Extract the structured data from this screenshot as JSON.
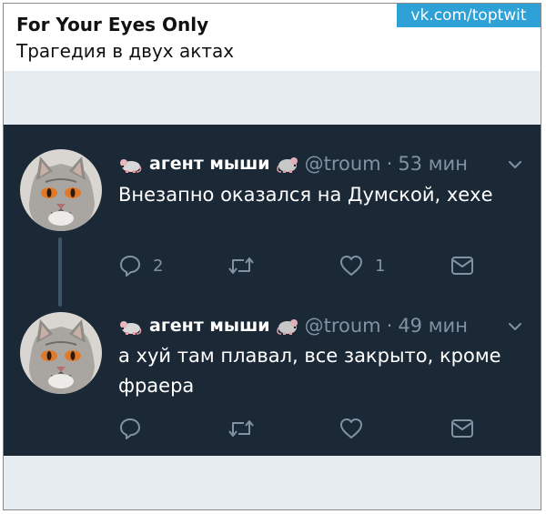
{
  "post": {
    "title": "For Your Eyes Only",
    "subtitle": "Трагедия в двух актах",
    "watermark": "vk.com/toptwit"
  },
  "tweets": [
    {
      "display_name": "агент мыши",
      "handle": "@troum",
      "separator": "·",
      "time": "53 мин",
      "text": "Внезапно оказался на Думской, хехе",
      "reply_count": "2",
      "retweet_count": "",
      "like_count": "1",
      "icons": [
        "mouse-emoji-icon",
        "rat-emoji-icon",
        "chevron-down-icon",
        "reply-icon",
        "retweet-icon",
        "heart-icon",
        "envelope-icon"
      ]
    },
    {
      "display_name": "агент мыши",
      "handle": "@troum",
      "separator": "·",
      "time": "49 мин",
      "text": "а хуй там плавал, все закрыто, кроме фраера",
      "reply_count": "",
      "retweet_count": "",
      "like_count": "",
      "icons": [
        "mouse-emoji-icon",
        "rat-emoji-icon",
        "chevron-down-icon",
        "reply-icon",
        "retweet-icon",
        "heart-icon",
        "envelope-icon"
      ]
    }
  ],
  "colors": {
    "panel_background": "#1b2836",
    "band_background": "#e6ecf0",
    "watermark_background": "#2ea1d6",
    "muted_text": "#7f93a4",
    "primary_text": "#ffffff",
    "thread_line": "#3d5466"
  }
}
